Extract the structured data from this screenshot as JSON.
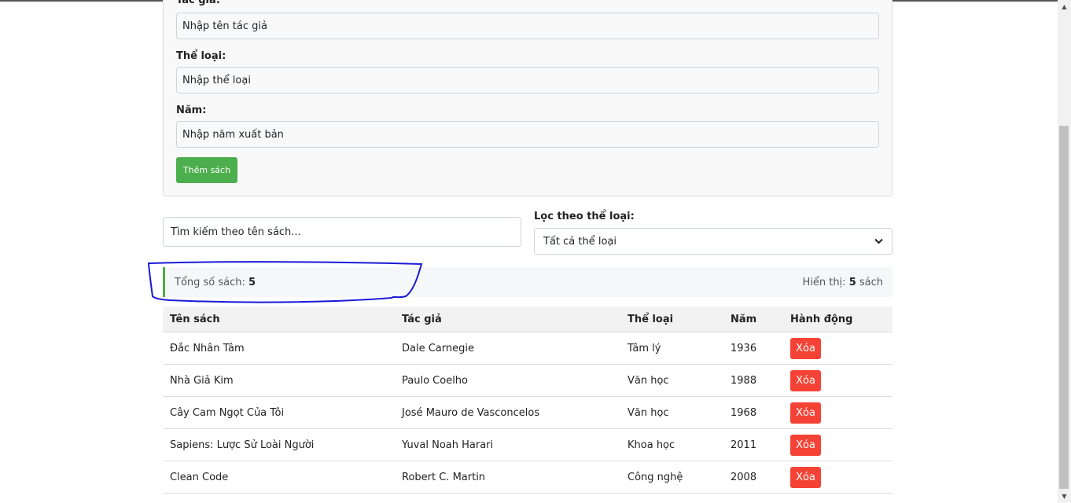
{
  "form": {
    "author_label": "Tác giả:",
    "author_placeholder": "Nhập tên tác giả",
    "genre_label": "Thể loại:",
    "genre_placeholder": "Nhập thể loại",
    "year_label": "Năm:",
    "year_placeholder": "Nhập năm xuất bản",
    "add_button": "Thêm sách"
  },
  "search": {
    "placeholder": "Tìm kiếm theo tên sách..."
  },
  "filter": {
    "label": "Lọc theo thể loại:",
    "selected": "Tất cả thể loại"
  },
  "stats": {
    "total_label": "Tổng số sách: ",
    "total_value": "5",
    "shown_label": "Hiển thị: ",
    "shown_value": "5",
    "shown_unit": " sách"
  },
  "table": {
    "headers": [
      "Tên sách",
      "Tác giả",
      "Thể loại",
      "Năm",
      "Hành động"
    ],
    "rows": [
      {
        "title": "Đắc Nhân Tâm",
        "author": "Dale Carnegie",
        "genre": "Tâm lý",
        "year": "1936",
        "action": "Xóa"
      },
      {
        "title": "Nhà Giả Kim",
        "author": "Paulo Coelho",
        "genre": "Văn học",
        "year": "1988",
        "action": "Xóa"
      },
      {
        "title": "Cây Cam Ngọt Của Tôi",
        "author": "José Mauro de Vasconcelos",
        "genre": "Văn học",
        "year": "1968",
        "action": "Xóa"
      },
      {
        "title": "Sapiens: Lược Sử Loài Người",
        "author": "Yuval Noah Harari",
        "genre": "Khoa học",
        "year": "2011",
        "action": "Xóa"
      },
      {
        "title": "Clean Code",
        "author": "Robert C. Martin",
        "genre": "Công nghệ",
        "year": "2008",
        "action": "Xóa"
      }
    ]
  },
  "colors": {
    "accent_green": "#4cae4c",
    "delete_red": "#f44336",
    "annotation_blue": "#1a1ad6"
  },
  "icons": {
    "select": "chevron-down-icon",
    "scroll_up": "arrow-up-icon",
    "scroll_down": "arrow-down-icon"
  }
}
